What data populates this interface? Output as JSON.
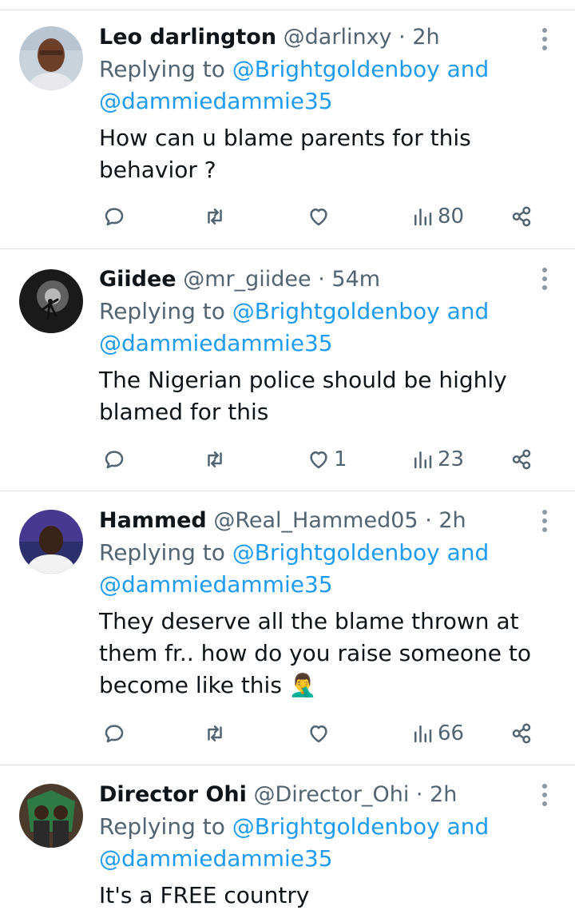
{
  "tweets": [
    {
      "name": "Leo darlington",
      "handle": "@darlinxy",
      "separator": "·",
      "time": "2h",
      "replying_prefix": "Replying to",
      "reply_to_1": "@Brightgoldenboy",
      "reply_and": "and",
      "reply_to_2": "@dammiedammie35",
      "text_line_1": "How can u blame parents for this",
      "text_line_2": "behavior ?",
      "likes": "",
      "views": "80",
      "avatar_icon": "user-avatar-photo"
    },
    {
      "name": "Giidee",
      "handle": "@mr_giidee",
      "separator": "·",
      "time": "54m",
      "replying_prefix": "Replying to",
      "reply_to_1": "@Brightgoldenboy",
      "reply_and": "and",
      "reply_to_2": "@dammiedammie35",
      "text_line_1": "The Nigerian police should be highly",
      "text_line_2": "blamed for this",
      "likes": "1",
      "views": "23",
      "avatar_icon": "user-avatar-silhouette"
    },
    {
      "name": "Hammed",
      "handle": "@Real_Hammed05",
      "separator": "·",
      "time": "2h",
      "replying_prefix": "Replying to",
      "reply_to_1": "@Brightgoldenboy",
      "reply_and": "and",
      "reply_to_2": "@dammiedammie35",
      "text_line_1": "They deserve all the blame thrown at",
      "text_line_2": "them fr.. how do you raise someone to",
      "text_line_3": "become like this 🤦‍♂️",
      "likes": "",
      "views": "66",
      "avatar_icon": "user-avatar-photo"
    },
    {
      "name": "Director Ohi",
      "handle": "@Director_Ohi",
      "separator": "·",
      "time": "2h",
      "replying_prefix": "Replying to",
      "reply_to_1": "@Brightgoldenboy",
      "reply_and": "and",
      "reply_to_2": "@dammiedammie35",
      "text_line_1": "It's a FREE country",
      "avatar_icon": "user-avatar-illustration"
    }
  ],
  "colors": {
    "link": "#1d9bf0",
    "secondary_text": "#536471",
    "primary_text": "#0f1419",
    "divider": "#dfe3e6"
  }
}
